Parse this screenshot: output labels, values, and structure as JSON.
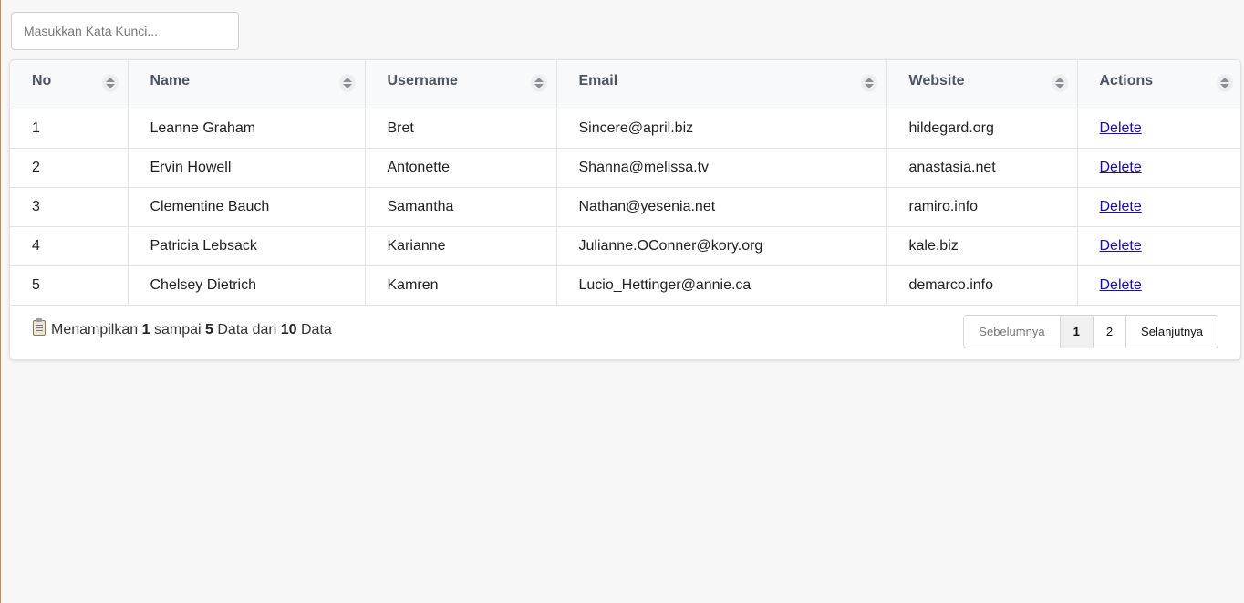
{
  "search": {
    "placeholder": "Masukkan Kata Kunci..."
  },
  "table": {
    "headers": [
      "No",
      "Name",
      "Username",
      "Email",
      "Website",
      "Actions"
    ],
    "rows": [
      {
        "no": "1",
        "name": "Leanne Graham",
        "username": "Bret",
        "email": "Sincere@april.biz",
        "website": "hildegard.org",
        "action": "Delete"
      },
      {
        "no": "2",
        "name": "Ervin Howell",
        "username": "Antonette",
        "email": "Shanna@melissa.tv",
        "website": "anastasia.net",
        "action": "Delete"
      },
      {
        "no": "3",
        "name": "Clementine Bauch",
        "username": "Samantha",
        "email": "Nathan@yesenia.net",
        "website": "ramiro.info",
        "action": "Delete"
      },
      {
        "no": "4",
        "name": "Patricia Lebsack",
        "username": "Karianne",
        "email": "Julianne.OConner@kory.org",
        "website": "kale.biz",
        "action": "Delete"
      },
      {
        "no": "5",
        "name": "Chelsey Dietrich",
        "username": "Kamren",
        "email": "Lucio_Hettinger@annie.ca",
        "website": "demarco.info",
        "action": "Delete"
      }
    ]
  },
  "summary": {
    "icon": "clipboard-icon",
    "prefix": "Menampilkan",
    "from": "1",
    "mid": "sampai",
    "to": "5",
    "mid2": "Data dari",
    "total": "10",
    "suffix": "Data"
  },
  "pagination": {
    "prev": "Sebelumnya",
    "pages": [
      "1",
      "2"
    ],
    "next": "Selanjutnya",
    "active_page": "1"
  }
}
